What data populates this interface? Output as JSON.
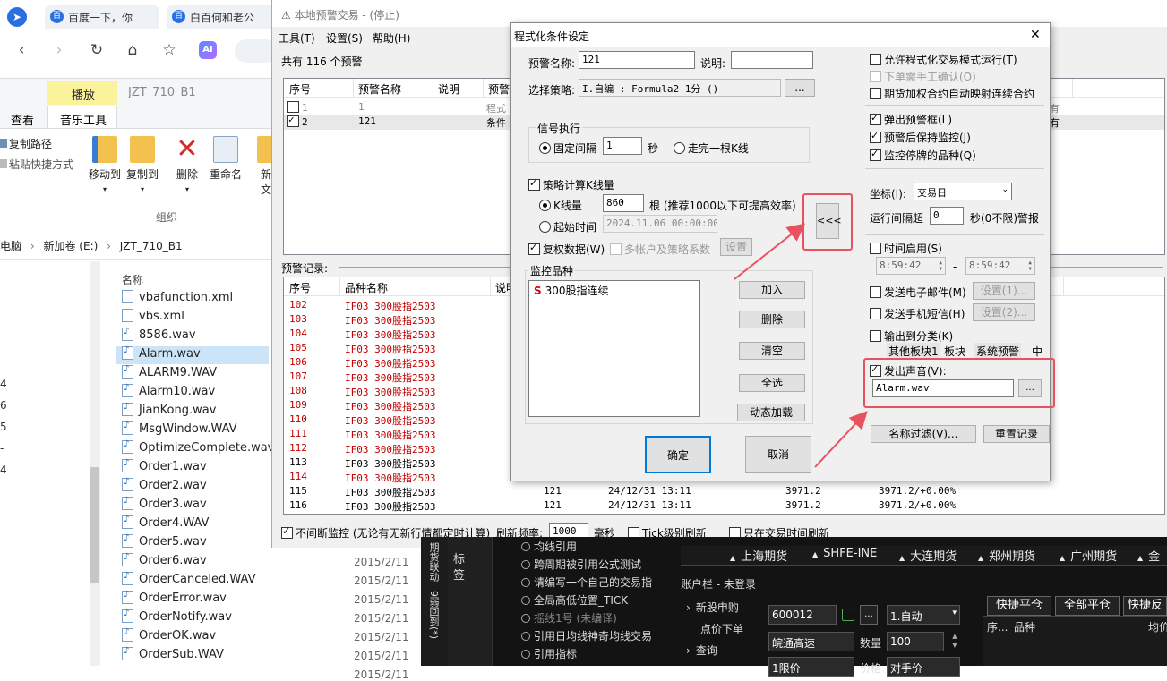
{
  "browser": {
    "tabs": [
      "百度一下，你",
      "白百何和老公"
    ],
    "ai_label": "AI"
  },
  "explorer": {
    "ribbon_tabs": {
      "play": "播放",
      "folder": "JZT_710_B1",
      "view": "查看",
      "music": "音乐工具"
    },
    "copy_path": "复制路径",
    "paste_shortcut": "粘贴快捷方式",
    "move_to": "移动到",
    "copy_to": "复制到",
    "delete": "删除",
    "rename": "重命名",
    "new_folder_1": "新",
    "new_folder_2": "文",
    "group": "组织",
    "address": [
      "电脑",
      "新加卷 (E:)",
      "JZT_710_B1"
    ],
    "column_name": "名称",
    "left_numbers": [
      "4",
      "6",
      "5",
      "-",
      "4"
    ],
    "files": [
      {
        "name": "vbafunction.xml",
        "type": "x"
      },
      {
        "name": "vbs.xml",
        "type": "x"
      },
      {
        "name": "8586.wav",
        "type": "w"
      },
      {
        "name": "Alarm.wav",
        "type": "w",
        "selected": true
      },
      {
        "name": "ALARM9.WAV",
        "type": "w"
      },
      {
        "name": "Alarm10.wav",
        "type": "w"
      },
      {
        "name": "JianKong.wav",
        "type": "w"
      },
      {
        "name": "MsgWindow.WAV",
        "type": "w"
      },
      {
        "name": "OptimizeComplete.wav",
        "type": "w"
      },
      {
        "name": "Order1.wav",
        "type": "w"
      },
      {
        "name": "Order2.wav",
        "type": "w"
      },
      {
        "name": "Order3.wav",
        "type": "w"
      },
      {
        "name": "Order4.WAV",
        "type": "w"
      },
      {
        "name": "Order5.wav",
        "type": "w"
      },
      {
        "name": "Order6.wav",
        "type": "w"
      },
      {
        "name": "OrderCanceled.WAV",
        "type": "w"
      },
      {
        "name": "OrderError.wav",
        "type": "w"
      },
      {
        "name": "OrderNotify.wav",
        "type": "w"
      },
      {
        "name": "OrderOK.wav",
        "type": "w"
      },
      {
        "name": "OrderSub.WAV",
        "type": "w"
      }
    ],
    "dates": [
      "2015/2/11",
      "2015/2/11",
      "2015/2/11",
      "2015/2/11",
      "2015/2/11",
      "2015/2/11",
      "2015/2/11"
    ]
  },
  "main": {
    "title": "本地预警交易 - (停止)",
    "menu": [
      "工具(T)",
      "设置(S)",
      "帮助(H)"
    ],
    "count_text": "共有 116 个预警",
    "table_headers": [
      "序号",
      "预警名称",
      "说明",
      "预警"
    ],
    "rows": [
      {
        "no": "1",
        "name": "1",
        "desc": "程式",
        "checked": false
      },
      {
        "no": "2",
        "name": "121",
        "desc": "条件",
        "checked": true
      }
    ],
    "bg_digits": [
      "有",
      "有"
    ],
    "record_label": "预警记录:",
    "record_headers": [
      "序号",
      "品种名称",
      "说明"
    ],
    "records": [
      {
        "no": "102",
        "name": "IF03 300股指2503",
        "red": true
      },
      {
        "no": "103",
        "name": "IF03 300股指2503",
        "red": true
      },
      {
        "no": "104",
        "name": "IF03 300股指2503",
        "red": true
      },
      {
        "no": "105",
        "name": "IF03 300股指2503",
        "red": true
      },
      {
        "no": "106",
        "name": "IF03 300股指2503",
        "red": true
      },
      {
        "no": "107",
        "name": "IF03 300股指2503",
        "red": true
      },
      {
        "no": "108",
        "name": "IF03 300股指2503",
        "red": true
      },
      {
        "no": "109",
        "name": "IF03 300股指2503",
        "red": true
      },
      {
        "no": "110",
        "name": "IF03 300股指2503",
        "red": true
      },
      {
        "no": "111",
        "name": "IF03 300股指2503",
        "red": true
      },
      {
        "no": "112",
        "name": "IF03 300股指2503",
        "red": true
      },
      {
        "no": "113",
        "name": "IF03 300股指2503",
        "red": false
      },
      {
        "no": "114",
        "name": "IF03 300股指2503",
        "red": true
      },
      {
        "no": "115",
        "name": "IF03 300股指2503",
        "red": false,
        "code": "121",
        "time": "24/12/31 13:11",
        "price": "3971.2",
        "change": "3971.2/+0.00%"
      },
      {
        "no": "116",
        "name": "IF03 300股指2503",
        "red": false,
        "code": "121",
        "time": "24/12/31 13:11",
        "price": "3971.2",
        "change": "3971.2/+0.00%"
      }
    ],
    "bottom": {
      "continuous": "不间断监控 (无论有无新行情都定时计算)",
      "refresh_label": "刷新频率:",
      "refresh_value": "1000",
      "ms": "毫秒",
      "tick": "Tick级别刷新",
      "trade_only": "只在交易时间刷新"
    }
  },
  "dialog": {
    "title": "程式化条件设定",
    "close": "✕",
    "name_label": "预警名称:",
    "name_value": "121",
    "desc_label": "说明:",
    "desc_value": "",
    "strategy_label": "选择策略:",
    "strategy_value": "I.自编 : Formula2 1分 ()",
    "browse": "...",
    "signal_group": "信号执行",
    "fixed_interval": "固定间隔",
    "interval_value": "1",
    "seconds": "秒",
    "bar_end": "走完一根K线",
    "calc_kline": "策略计算K线量",
    "kline_count": "K线量",
    "kline_value": "860",
    "kline_hint": "根 (推荐1000以下可提高效率)",
    "start_time": "起始时间",
    "start_value": "2024.11.06 00:00:00",
    "rights": "复权数据(W)",
    "multi_account": "多帐户及策略系数",
    "settings": "设置",
    "arrow": "<<<",
    "monitor_group": "监控品种",
    "monitor_item_icon": "S",
    "monitor_item": "300股指连续",
    "add": "加入",
    "remove": "删除",
    "clear": "清空",
    "select_all": "全选",
    "dynamic": "动态加载",
    "ok": "确定",
    "cancel": "取消",
    "allow_auto": "允许程式化交易模式运行(T)",
    "manual_confirm": "下单需手工确认(O)",
    "futures_map": "期货加权合约自动映射连续合约",
    "popup": "弹出预警框(L)",
    "keep_monitor": "预警后保持监控(J)",
    "monitor_suspend": "监控停牌的品种(Q)",
    "axis_label": "坐标(I):",
    "axis_value": "交易日",
    "run_interval": "运行间隔超",
    "run_value": "0",
    "run_hint": "秒(0不限)警报",
    "time_enable": "时间启用(S)",
    "time_from": "8:59:42",
    "time_to": "8:59:42",
    "dash": "-",
    "email": "发送电子邮件(M)",
    "email_set": "设置(1)...",
    "sms": "发送手机短信(H)",
    "sms_set": "设置(2)...",
    "output_cat": "输出到分类(K)",
    "cat_tabs": [
      "其他板块1",
      "板块",
      "系统预警",
      "中"
    ],
    "sound": "发出声音(V):",
    "sound_file": "Alarm.wav",
    "name_filter": "名称过滤(V)...",
    "reset_record": "重置记录"
  },
  "terminal": {
    "vertical_tabs": [
      "标",
      "签"
    ],
    "side_label": "期货联动",
    "side_label2": "9弱回到(*)",
    "list": [
      "均线引用",
      "跨周期被引用公式测试",
      "请编写一个自己的交易指",
      "全局高低位置_TICK",
      "摇线1号 (未编译)",
      "引用日均线神奇均线交易",
      "引用指标"
    ],
    "markets": [
      "上海期货",
      "SHFE-INE",
      "大连期货",
      "郑州期货",
      "广州期货",
      "金"
    ],
    "account": "账户栏",
    "login": "未登录",
    "nav": [
      "新股申购",
      "点价下单",
      "查询"
    ],
    "code_value": "600012",
    "stock_name": "皖通高速",
    "qty_label": "数量",
    "qty_value": "100",
    "mode_value": "1.自动",
    "price_label": "价格",
    "price_value": "对手价",
    "limit_value": "1限价",
    "quick_close": "快捷平仓",
    "close_all": "全部平仓",
    "quick_reverse": "快捷反",
    "grid_headers": [
      "序...",
      "品种",
      "均价"
    ]
  }
}
